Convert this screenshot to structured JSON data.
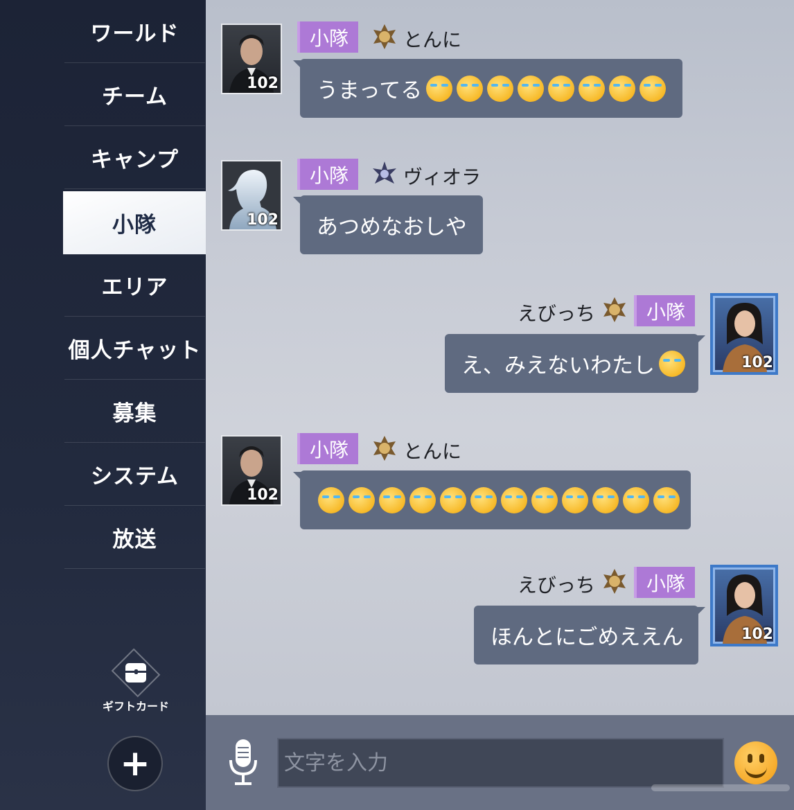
{
  "sidebar": {
    "items": [
      {
        "label": "ワールド",
        "active": false
      },
      {
        "label": "チーム",
        "active": false
      },
      {
        "label": "キャンプ",
        "active": false
      },
      {
        "label": "小隊",
        "active": true
      },
      {
        "label": "エリア",
        "active": false
      },
      {
        "label": "個人チャット",
        "active": false
      },
      {
        "label": "募集",
        "active": false
      },
      {
        "label": "システム",
        "active": false
      },
      {
        "label": "放送",
        "active": false
      }
    ],
    "gift_label": "ギフトカード",
    "plus_symbol": "+"
  },
  "messages": [
    {
      "side": "left",
      "tag": "小隊",
      "name": "とんに",
      "level": "102",
      "text": "うまってる",
      "emoji_count": 8,
      "emoji": "face-with-tears-of-joy"
    },
    {
      "side": "left",
      "tag": "小隊",
      "name": "ヴィオラ",
      "level": "102",
      "text": "あつめなおしや",
      "emoji_count": 0
    },
    {
      "side": "right",
      "tag": "小隊",
      "name": "えびっち",
      "level": "102",
      "text": "え、みえないわたし",
      "emoji_count": 1,
      "emoji": "face-with-tears-of-joy"
    },
    {
      "side": "left",
      "tag": "小隊",
      "name": "とんに",
      "level": "102",
      "text": "",
      "emoji_count": 12,
      "emoji": "face-with-tears-of-joy"
    },
    {
      "side": "right",
      "tag": "小隊",
      "name": "えびっち",
      "level": "102",
      "text": "ほんとにごめええん",
      "emoji_count": 0
    }
  ],
  "input": {
    "placeholder": "文字を入力",
    "value": ""
  },
  "colors": {
    "sidebar_bg": "#1c2336",
    "chat_bg": "#c7cbd5",
    "bubble": "#5f6a80",
    "tag": "#ad79d6",
    "input_bar": "#697185"
  },
  "icons": [
    "microphone-icon",
    "smiley-icon",
    "gift-card-icon",
    "plus-icon",
    "rank-badge-icon"
  ]
}
